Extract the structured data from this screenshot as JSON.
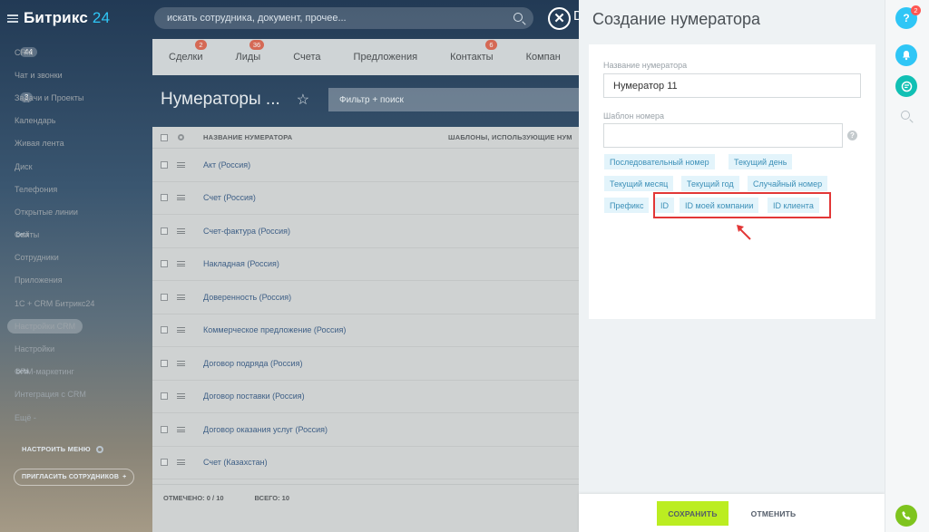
{
  "sidebar": {
    "logo_name": "Битрикс",
    "logo_num": "24",
    "items": [
      {
        "label": "CRM",
        "count": "44"
      },
      {
        "label": "Чат и звонки"
      },
      {
        "label": "Задачи и Проекты",
        "count": "3"
      },
      {
        "label": "Календарь"
      },
      {
        "label": "Живая лента"
      },
      {
        "label": "Диск"
      },
      {
        "label": "Телефония"
      },
      {
        "label": "Открытые линии"
      },
      {
        "label": "Сайты",
        "sup": "beta"
      },
      {
        "label": "Сотрудники"
      },
      {
        "label": "Приложения"
      },
      {
        "label": "1С + CRM Битрикс24"
      },
      {
        "label": "Настройки CRM",
        "active": true
      },
      {
        "label": "Настройки"
      },
      {
        "label": "CRM-маркетинг",
        "sup": "beta"
      },
      {
        "label": "Интеграция с CRM"
      },
      {
        "label": "Ещё -"
      }
    ],
    "config_menu": "НАСТРОИТЬ МЕНЮ",
    "invite": "ПРИГЛАСИТЬ СОТРУДНИКОВ",
    "invite_plus": "+"
  },
  "topbar": {
    "search_placeholder": "искать сотрудника, документ, прочее...",
    "close_symbol": "✕",
    "peek_letter": "D"
  },
  "tabs": [
    {
      "label": "Сделки",
      "badge": "2"
    },
    {
      "label": "Лиды",
      "badge": "36"
    },
    {
      "label": "Счета"
    },
    {
      "label": "Предложения"
    },
    {
      "label": "Контакты",
      "badge": "6"
    },
    {
      "label": "Компан"
    }
  ],
  "page": {
    "title": "Нумераторы ...",
    "star": "☆",
    "filter_placeholder": "Фильтр + поиск"
  },
  "grid": {
    "col_name": "НАЗВАНИЕ НУМЕРАТОРА",
    "col_templates": "ШАБЛОНЫ, ИСПОЛЬЗУЮЩИЕ НУМ",
    "rows": [
      "Акт (Россия)",
      "Счет (Россия)",
      "Счет-фактура (Россия)",
      "Накладная (Россия)",
      "Доверенность (Россия)",
      "Коммерческое предложение (Россия)",
      "Договор подряда (Россия)",
      "Договор поставки (Россия)",
      "Договор оказания услуг (Россия)",
      "Счет (Казахстан)"
    ],
    "selected": "ОТМЕЧЕНО: 0 / 10",
    "total": "ВСЕГО: 10"
  },
  "panel": {
    "title": "Создание нумератора",
    "name_label": "Название нумератора",
    "name_value": "Нумератор 11",
    "template_label": "Шаблон номера",
    "template_value": "",
    "help": "?",
    "chips": [
      "Последовательный номер",
      "Текущий день",
      "Текущий месяц",
      "Текущий год",
      "Случайный номер",
      "Префикс",
      "ID",
      "ID моей компании",
      "ID клиента"
    ],
    "save": "СОХРАНИТЬ",
    "cancel": "ОТМЕНИТЬ",
    "highlight_color": "#e23737"
  },
  "rail": {
    "help": "?",
    "help_badge": "2",
    "colors": {
      "help": "#2fc6f6",
      "bell": "#2fc6f6",
      "chat": "#11c0b4",
      "phone": "#7ec41e"
    }
  }
}
